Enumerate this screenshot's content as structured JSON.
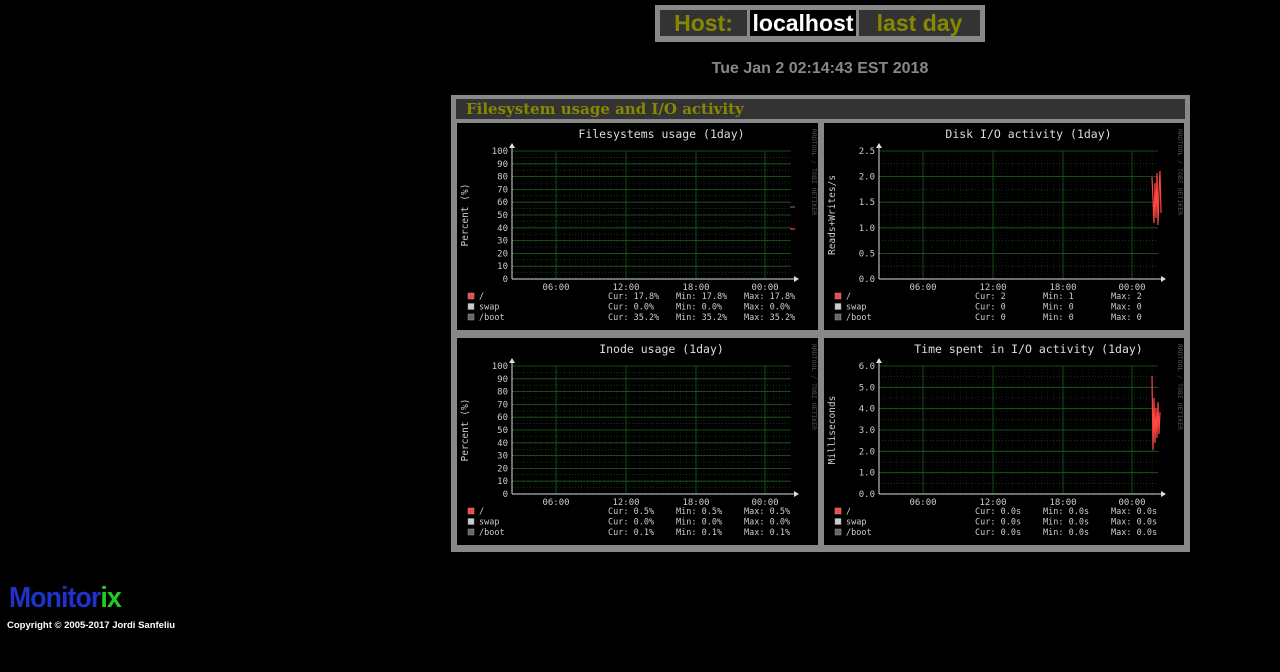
{
  "header": {
    "host_label": "Host:",
    "host_value": "localhost",
    "period": "last day"
  },
  "date": "Tue Jan 2 02:14:43 EST 2018",
  "section_title": "Filesystem usage and I/O activity",
  "watermark": "RRDTOOL / TOBI OETIKER",
  "colors": {
    "background": "#000000",
    "frame": "#888888",
    "title_bar": "#333333",
    "title_text": "#888800",
    "grid": "#1f5f1f",
    "series_root": "#ff4444",
    "series_swap": "#cccccc",
    "series_boot": "#666666"
  },
  "graphs": [
    {
      "title": "Filesystems usage  (1day)",
      "ylabel": "Percent (%)",
      "yticks": [
        "100",
        "90",
        "80",
        "70",
        "60",
        "50",
        "40",
        "30",
        "20",
        "10",
        "0"
      ],
      "xticks": [
        "06:00",
        "12:00",
        "18:00",
        "00:00"
      ],
      "legend": [
        {
          "name": "/",
          "cur": "Cur:  17.8%",
          "min": "Min:  17.8%",
          "max": "Max:  17.8%"
        },
        {
          "name": "swap",
          "cur": "Cur:   0.0%",
          "min": "Min:   0.0%",
          "max": "Max:   0.0%"
        },
        {
          "name": "/boot",
          "cur": "Cur:  35.2%",
          "min": "Min:  35.2%",
          "max": "Max:  35.2%"
        }
      ]
    },
    {
      "title": "Disk I/O activity  (1day)",
      "ylabel": "Reads+Writes/s",
      "yticks": [
        "2.5",
        "2.0",
        "1.5",
        "1.0",
        "0.5",
        "0.0"
      ],
      "xticks": [
        "06:00",
        "12:00",
        "18:00",
        "00:00"
      ],
      "legend": [
        {
          "name": "/",
          "cur": "Cur:     2",
          "min": "Min:     1",
          "max": "Max:     2"
        },
        {
          "name": "swap",
          "cur": "Cur:     0",
          "min": "Min:     0",
          "max": "Max:     0"
        },
        {
          "name": "/boot",
          "cur": "Cur:     0",
          "min": "Min:     0",
          "max": "Max:     0"
        }
      ]
    },
    {
      "title": "Inode usage  (1day)",
      "ylabel": "Percent (%)",
      "yticks": [
        "100",
        "90",
        "80",
        "70",
        "60",
        "50",
        "40",
        "30",
        "20",
        "10",
        "0"
      ],
      "xticks": [
        "06:00",
        "12:00",
        "18:00",
        "00:00"
      ],
      "legend": [
        {
          "name": "/",
          "cur": "Cur:   0.5%",
          "min": "Min:   0.5%",
          "max": "Max:   0.5%"
        },
        {
          "name": "swap",
          "cur": "Cur:   0.0%",
          "min": "Min:   0.0%",
          "max": "Max:   0.0%"
        },
        {
          "name": "/boot",
          "cur": "Cur:   0.1%",
          "min": "Min:   0.1%",
          "max": "Max:   0.1%"
        }
      ]
    },
    {
      "title": "Time spent in I/O activity  (1day)",
      "ylabel": "Milliseconds",
      "yticks": [
        "6.0",
        "5.0",
        "4.0",
        "3.0",
        "2.0",
        "1.0",
        "0.0"
      ],
      "xticks": [
        "06:00",
        "12:00",
        "18:00",
        "00:00"
      ],
      "legend": [
        {
          "name": "/",
          "cur": "Cur:   0.0s",
          "min": "Min:   0.0s",
          "max": "Max:   0.0s"
        },
        {
          "name": "swap",
          "cur": "Cur:   0.0s",
          "min": "Min:   0.0s",
          "max": "Max:   0.0s"
        },
        {
          "name": "/boot",
          "cur": "Cur:   0.0s",
          "min": "Min:   0.0s",
          "max": "Max:   0.0s"
        }
      ]
    }
  ],
  "logo": {
    "part1": "Monitor",
    "part2": "ix"
  },
  "copyright": "Copyright © 2005-2017 Jordi Sanfeliu"
}
